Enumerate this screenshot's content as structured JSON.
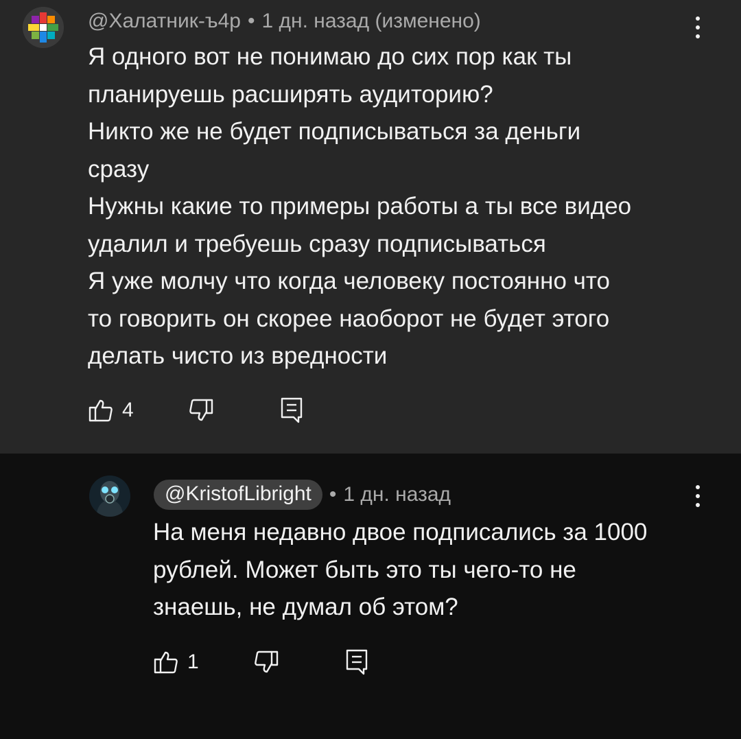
{
  "comments": [
    {
      "handle": "@Халатник-ъ4р",
      "separator": "•",
      "time": "1 дн. назад (изменено)",
      "text": "Я одного вот не понимаю до сих пор как ты\nпланируешь расширять аудиторию?\nНикто же не будет подписываться за деньги\nсразу\nНужны какие то примеры работы а ты все видео\nудалил и требуешь сразу подписываться\nЯ уже молчу что когда человеку постоянно что\nто говорить он скорее наоборот не будет этого\nделать чисто из вредности",
      "likes": "4",
      "icons": {
        "avatar": "colorful-star-avatar-icon",
        "like": "thumb-up-icon",
        "dislike": "thumb-down-icon",
        "reply": "reply-comment-icon",
        "menu": "more-vertical-icon"
      }
    },
    {
      "handle": "@KristofLibright",
      "separator": "•",
      "time": "1 дн. назад",
      "text": "На меня недавно двое подписались за 1000\nрублей. Может быть это ты чего-то не\nзнаешь, не думал об этом?",
      "likes": "1",
      "icons": {
        "avatar": "gasmask-avatar-icon",
        "like": "thumb-up-icon",
        "dislike": "thumb-down-icon",
        "reply": "reply-comment-icon",
        "menu": "more-vertical-icon"
      }
    }
  ],
  "colors": {
    "highlighted_bg": "#272727",
    "page_bg": "#0f0f0f",
    "primary_text": "#f1f1f1",
    "secondary_text": "#aaaaaa",
    "handle_pill_bg": "#3f3f3f"
  }
}
